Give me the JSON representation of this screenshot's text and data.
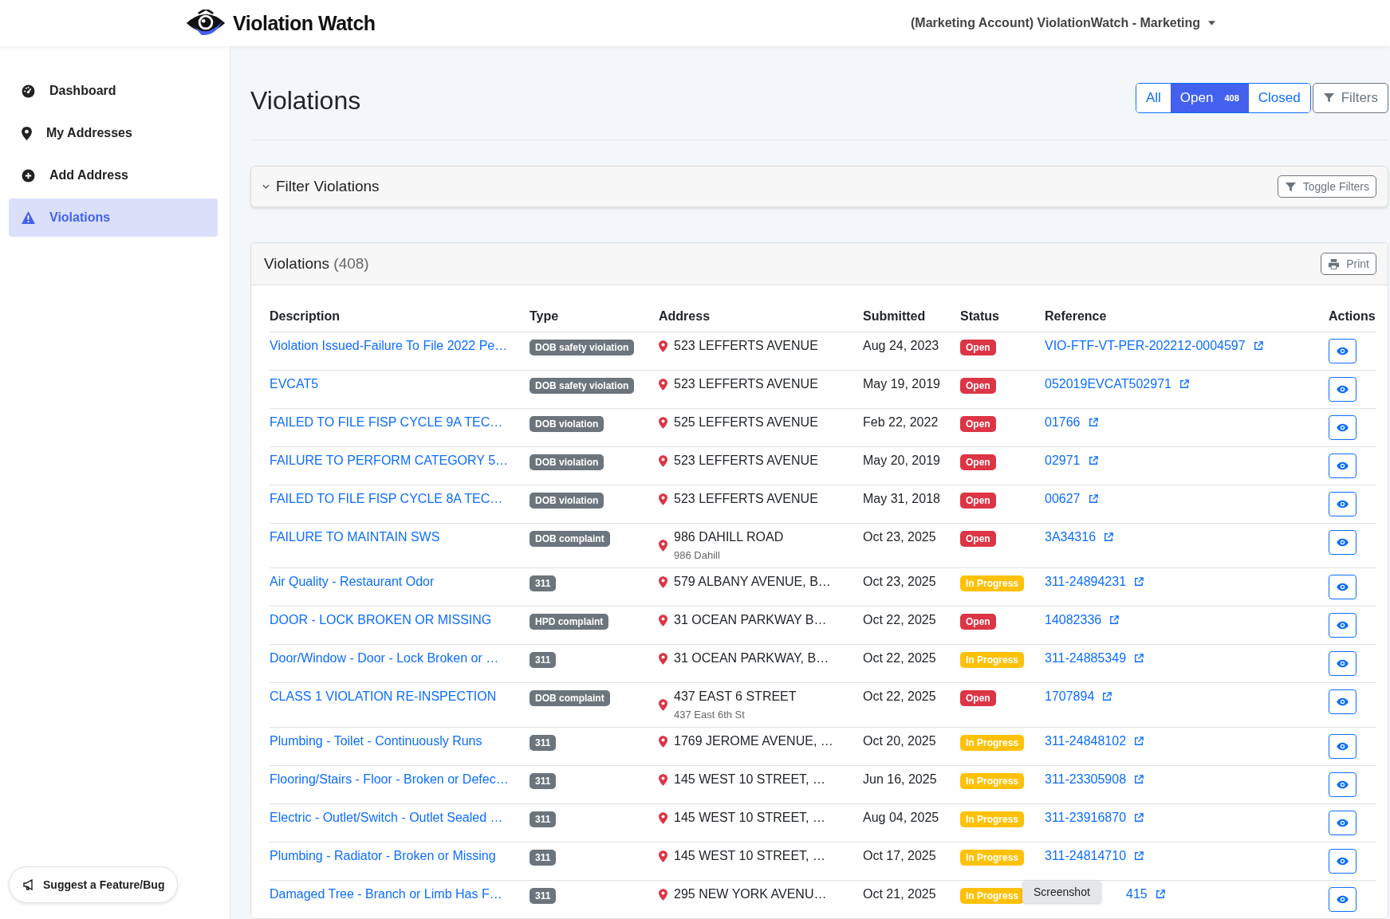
{
  "header": {
    "brand": "Violation Watch",
    "account": "(Marketing Account) ViolationWatch - Marketing"
  },
  "sidebar": {
    "items": [
      {
        "label": "Dashboard",
        "selected": false
      },
      {
        "label": "My Addresses",
        "selected": false
      },
      {
        "label": "Add Address",
        "selected": false
      },
      {
        "label": "Violations",
        "selected": true
      }
    ],
    "suggest_button": "Suggest a Feature/Bug"
  },
  "page_title": "Violations",
  "status_filter": [
    {
      "label": "All",
      "selected": false
    },
    {
      "label": "Open",
      "count": "408",
      "selected": true
    },
    {
      "label": "Closed",
      "selected": false
    }
  ],
  "filters_button": "Filters",
  "filter_panel": {
    "title": "Filter Violations",
    "toggle_button": "Toggle Filters"
  },
  "table": {
    "title": "Violations",
    "count": "(408)",
    "print_button": "Print",
    "columns": [
      "Description",
      "Type",
      "Address",
      "Submitted",
      "Status",
      "Reference",
      "Actions"
    ],
    "rows": [
      {
        "description": "Violation Issued-Failure To File 2022 Pe…",
        "type": "DOB safety violation",
        "address": "523 LEFFERTS AVENUE",
        "submitted": "Aug 24, 2023",
        "status": {
          "label": "Open",
          "kind": "open"
        },
        "reference": "VIO-FTF-VT-PER-202212-0004597"
      },
      {
        "description": "EVCAT5",
        "type": "DOB safety violation",
        "address": "523 LEFFERTS AVENUE",
        "submitted": "May 19, 2019",
        "status": {
          "label": "Open",
          "kind": "open"
        },
        "reference": "052019EVCAT502971"
      },
      {
        "description": "FAILED TO FILE FISP CYCLE 9A TEC…",
        "type": "DOB violation",
        "address": "525 LEFFERTS AVENUE",
        "submitted": "Feb 22, 2022",
        "status": {
          "label": "Open",
          "kind": "open"
        },
        "reference": "01766"
      },
      {
        "description": "FAILURE TO PERFORM CATEGORY 5…",
        "type": "DOB violation",
        "address": "523 LEFFERTS AVENUE",
        "submitted": "May 20, 2019",
        "status": {
          "label": "Open",
          "kind": "open"
        },
        "reference": "02971"
      },
      {
        "description": "FAILED TO FILE FISP CYCLE 8A TEC…",
        "type": "DOB violation",
        "address": "523 LEFFERTS AVENUE",
        "submitted": "May 31, 2018",
        "status": {
          "label": "Open",
          "kind": "open"
        },
        "reference": "00627"
      },
      {
        "description": "FAILURE TO MAINTAIN SWS",
        "type": "DOB complaint",
        "address": "986 DAHILL ROAD",
        "address_note": "986 Dahill",
        "submitted": "Oct 23, 2025",
        "status": {
          "label": "Open",
          "kind": "open"
        },
        "reference": "3A34316"
      },
      {
        "description": "Air Quality - Restaurant Odor",
        "type": "311",
        "address": "579 ALBANY AVENUE, B…",
        "submitted": "Oct 23, 2025",
        "status": {
          "label": "In Progress",
          "kind": "in_progress"
        },
        "reference": "311-24894231"
      },
      {
        "description": "DOOR - LOCK BROKEN OR MISSING",
        "type": "HPD complaint",
        "address": "31 OCEAN PARKWAY B…",
        "submitted": "Oct 22, 2025",
        "status": {
          "label": "Open",
          "kind": "open"
        },
        "reference": "14082336"
      },
      {
        "description": "Door/Window - Door - Lock Broken or …",
        "type": "311",
        "address": "31 OCEAN PARKWAY, B…",
        "submitted": "Oct 22, 2025",
        "status": {
          "label": "In Progress",
          "kind": "in_progress"
        },
        "reference": "311-24885349"
      },
      {
        "description": "CLASS 1 VIOLATION RE-INSPECTION",
        "type": "DOB complaint",
        "address": "437 EAST 6 STREET",
        "address_note": "437 East 6th St",
        "submitted": "Oct 22, 2025",
        "status": {
          "label": "Open",
          "kind": "open"
        },
        "reference": "1707894"
      },
      {
        "description": "Plumbing - Toilet - Continuously Runs",
        "type": "311",
        "address": "1769 JEROME AVENUE, …",
        "submitted": "Oct 20, 2025",
        "status": {
          "label": "In Progress",
          "kind": "in_progress"
        },
        "reference": "311-24848102"
      },
      {
        "description": "Flooring/Stairs - Floor - Broken or Defec…",
        "type": "311",
        "address": "145 WEST 10 STREET, …",
        "submitted": "Jun 16, 2025",
        "status": {
          "label": "In Progress",
          "kind": "in_progress"
        },
        "reference": "311-23305908"
      },
      {
        "description": "Electric - Outlet/Switch - Outlet Sealed …",
        "type": "311",
        "address": "145 WEST 10 STREET, …",
        "submitted": "Aug 04, 2025",
        "status": {
          "label": "In Progress",
          "kind": "in_progress"
        },
        "reference": "311-23916870"
      },
      {
        "description": "Plumbing - Radiator - Broken or Missing",
        "type": "311",
        "address": "145 WEST 10 STREET, …",
        "submitted": "Oct 17, 2025",
        "status": {
          "label": "In Progress",
          "kind": "in_progress"
        },
        "reference": "311-24814710"
      },
      {
        "description": "Damaged Tree - Branch or Limb Has F…",
        "type": "311",
        "address": "295 NEW YORK AVENU…",
        "submitted": "Oct 21, 2025",
        "status": {
          "label": "In Progress",
          "kind": "in_progress"
        },
        "reference": "415",
        "tooltip": "Screenshot"
      }
    ]
  }
}
